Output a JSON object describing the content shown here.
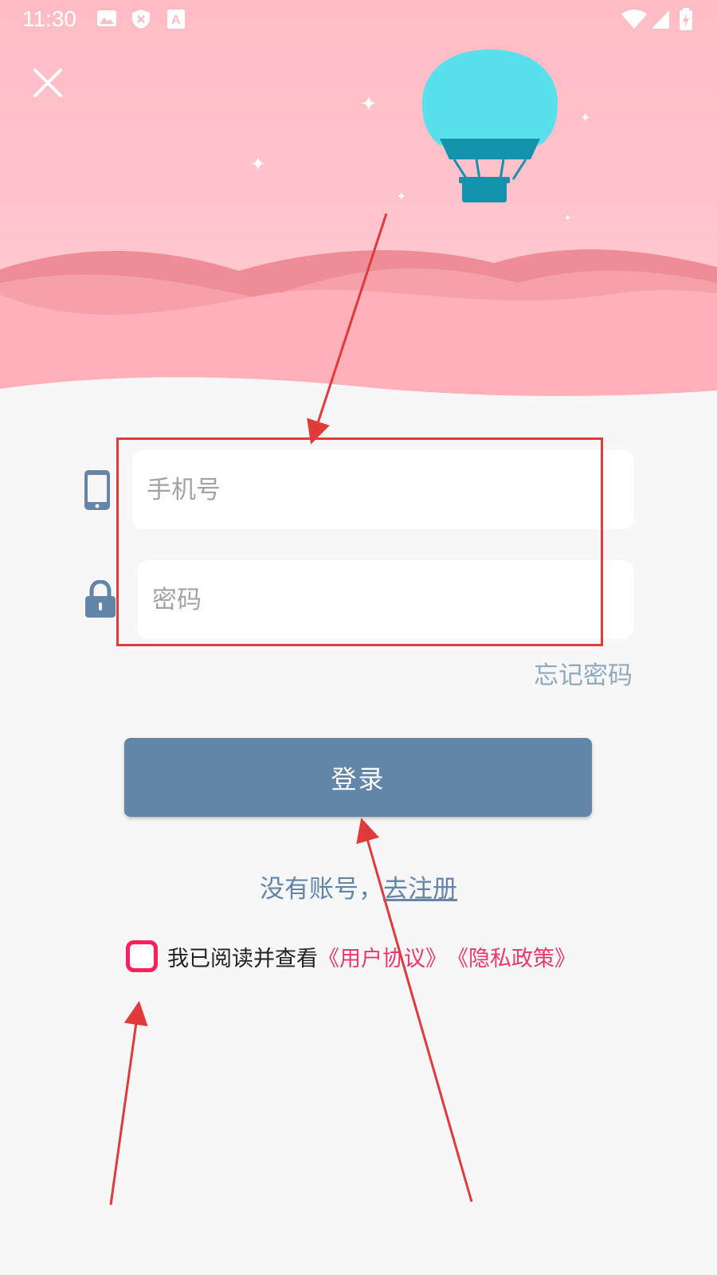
{
  "status_bar": {
    "time": "11:30",
    "icons": [
      "image-icon",
      "shield-x-icon",
      "font-a-icon",
      "wifi-icon",
      "signal-icon",
      "battery-charging-icon"
    ]
  },
  "header": {
    "close_icon": "close-icon"
  },
  "form": {
    "phone_placeholder": "手机号",
    "password_placeholder": "密码",
    "forgot_password": "忘记密码",
    "login_button": "登录"
  },
  "register": {
    "prefix": "没有账号，",
    "link": "去注册"
  },
  "agreement": {
    "text": "我已阅读并查看",
    "user_agreement": "《用户协议》",
    "privacy_policy": "《隐私政策》",
    "checked": false
  },
  "colors": {
    "hero_bg": "#ffbcc5",
    "primary": "#6386a8",
    "checkbox_border": "#ff1f5a",
    "link_red": "#e8396a",
    "annotation_red": "#e03a3a"
  }
}
